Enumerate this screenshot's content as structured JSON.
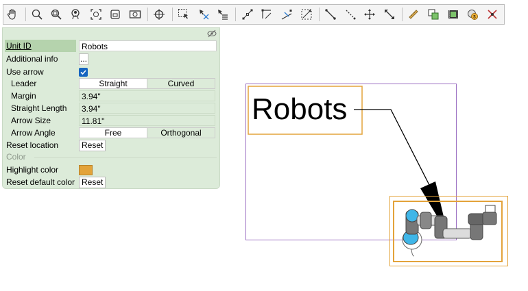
{
  "toolbar": {
    "icons": [
      "hand-icon",
      "zoom-icon",
      "zoom-in-icon",
      "zoom-user-icon",
      "zoom-fit-icon",
      "zoom-window-icon",
      "camera-icon",
      "center-icon",
      "select-icon",
      "deselect-icon",
      "select-list-icon",
      "snap-points-icon",
      "snap-corner-icon",
      "snap-edge-icon",
      "snap-grid-icon",
      "connector-icon",
      "diagonal-icon",
      "move-icon",
      "resize-icon",
      "ruler-icon",
      "copy-icon",
      "film-icon",
      "cost-icon",
      "delete-icon"
    ]
  },
  "panel": {
    "unit_id_label": "Unit ID",
    "unit_id_value": "Robots",
    "additional_info_label": "Additional info",
    "additional_info_button": "...",
    "use_arrow_label": "Use arrow",
    "use_arrow_checked": true,
    "leader_label": "Leader",
    "leader_options": [
      "Straight",
      "Curved"
    ],
    "leader_selected": "Straight",
    "margin_label": "Margin",
    "margin_value": "3.94\"",
    "straight_length_label": "Straight Length",
    "straight_length_value": "3.94\"",
    "arrow_size_label": "Arrow Size",
    "arrow_size_value": "11.81\"",
    "arrow_angle_label": "Arrow Angle",
    "arrow_angle_options": [
      "Free",
      "Orthogonal"
    ],
    "arrow_angle_selected": "Free",
    "reset_location_label": "Reset location",
    "reset_button": "Reset",
    "color_section": "Color",
    "highlight_color_label": "Highlight color",
    "highlight_color": "#e3a33a",
    "reset_default_color_label": "Reset default color",
    "reset_color_button": "Reset"
  },
  "canvas": {
    "label_text": "Robots",
    "frame_color": "#9b6fc2",
    "highlight_color": "#e3a33a"
  }
}
